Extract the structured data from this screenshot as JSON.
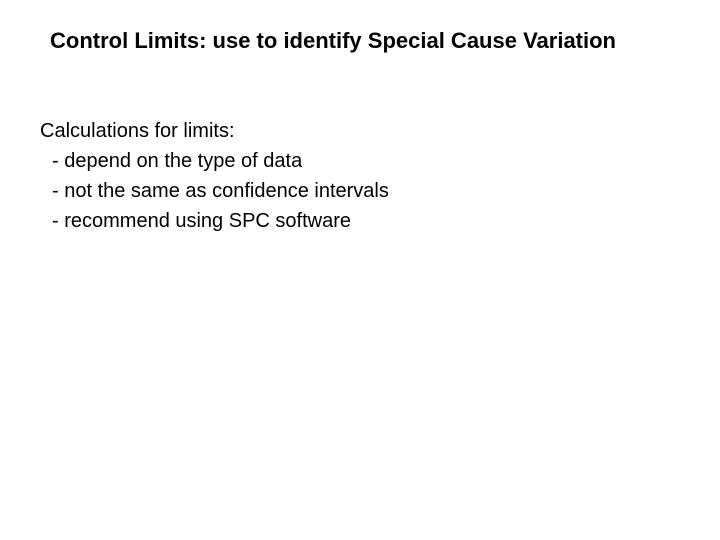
{
  "title": "Control Limits: use to identify Special Cause Variation",
  "intro": "Calculations for limits:",
  "bullets": [
    "- depend on the type of data",
    "- not the same as confidence intervals",
    "- recommend using SPC software"
  ]
}
